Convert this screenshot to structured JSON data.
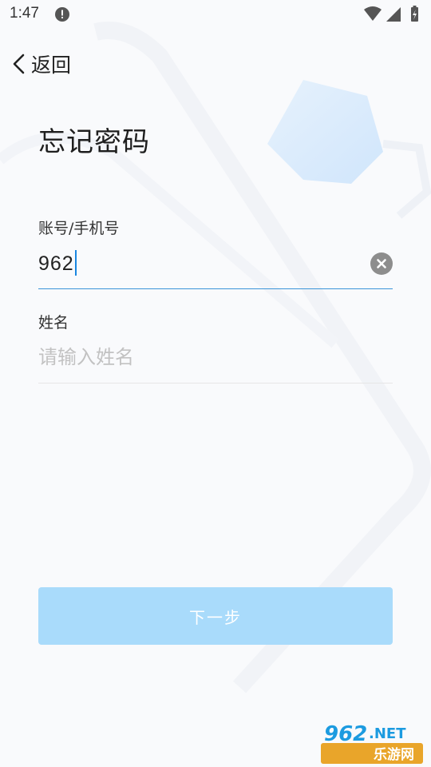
{
  "status_bar": {
    "time": "1:47"
  },
  "nav": {
    "back_label": "返回"
  },
  "page": {
    "title": "忘记密码"
  },
  "form": {
    "account": {
      "label": "账号/手机号",
      "value": "962"
    },
    "name": {
      "label": "姓名",
      "placeholder": "请输入姓名",
      "value": ""
    }
  },
  "actions": {
    "next_label": "下一步"
  },
  "watermark": {
    "brand_number": "962",
    "brand_suffix": ".NET",
    "brand_cn": "乐游网"
  },
  "colors": {
    "background": "#f9fafc",
    "accent": "#3a94d8",
    "button_disabled": "#a9dbfb",
    "clear_icon": "#8d8d8d"
  }
}
